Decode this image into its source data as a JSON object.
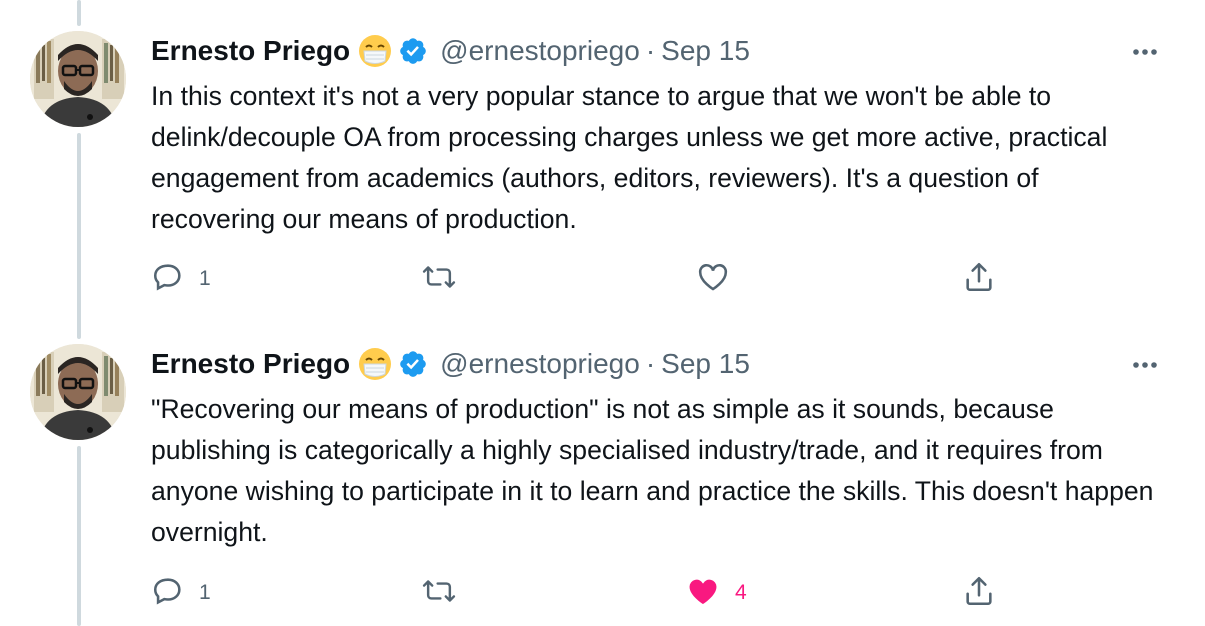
{
  "tweets": [
    {
      "author_name": "Ernesto Priego",
      "author_emoji": "face-with-medical-mask",
      "verified": true,
      "handle": "@ernestopriego",
      "separator": "·",
      "date": "Sep 15",
      "text": "In this context it's not a very popular stance to argue that we won't be able to delink/decouple OA from processing charges unless we get more active, practical engagement from academics (authors, editors, reviewers). It's a question of recovering our means of production.",
      "reply_count": "1",
      "retweet_count": "",
      "like_count": "",
      "liked": false,
      "icons": {
        "reply": "reply-icon",
        "retweet": "retweet-icon",
        "like": "heart-outline-icon",
        "share": "share-icon",
        "more": "more-dots-icon"
      }
    },
    {
      "author_name": "Ernesto Priego",
      "author_emoji": "face-with-medical-mask",
      "verified": true,
      "handle": "@ernestopriego",
      "separator": "·",
      "date": "Sep 15",
      "text": "\"Recovering our means of production\" is not as simple as it sounds, because publishing is categorically a highly specialised industry/trade, and it requires from anyone wishing to participate in it to learn and practice the skills. This doesn't happen overnight.",
      "reply_count": "1",
      "retweet_count": "",
      "like_count": "4",
      "liked": true,
      "icons": {
        "reply": "reply-icon",
        "retweet": "retweet-icon",
        "like": "heart-filled-icon",
        "share": "share-icon",
        "more": "more-dots-icon"
      }
    }
  ],
  "colors": {
    "text": "#0f1419",
    "secondary": "#536471",
    "thread_line": "#cfd9de",
    "verified": "#1d9bf0",
    "like": "#f91880"
  }
}
